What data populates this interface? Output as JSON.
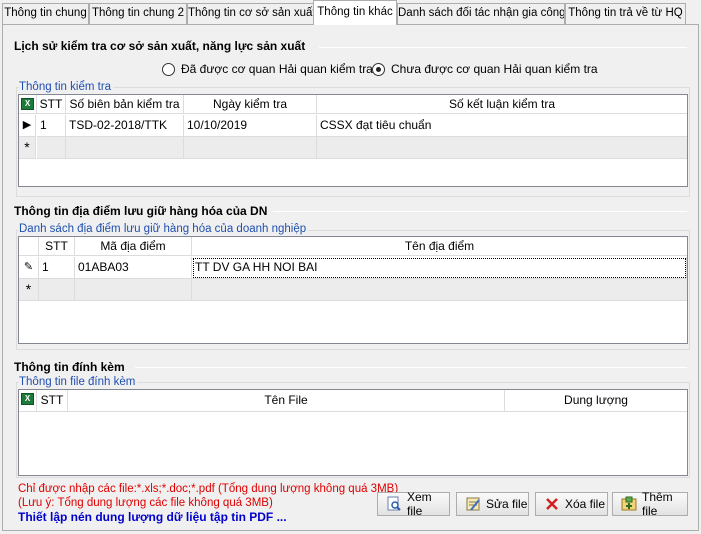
{
  "tabs": [
    {
      "label": "Thông tin chung"
    },
    {
      "label": "Thông tin chung 2"
    },
    {
      "label": "Thông tin cơ sở sản xuất"
    },
    {
      "label": "Thông tin khác"
    },
    {
      "label": "Danh sách đối tác nhận gia công"
    },
    {
      "label": "Thông tin trả về từ HQ"
    }
  ],
  "inspection": {
    "section_title": "Lịch sử kiểm tra cơ sở sản xuất, năng lực sản xuất",
    "radio_checked_label": "Đã được cơ quan Hải quan kiểm tra",
    "radio_unchecked_label": "Chưa được cơ quan Hải quan kiểm tra",
    "group_title": "Thông tin kiểm tra",
    "columns": [
      "STT",
      "Số biên bản kiểm tra",
      "Ngày kiểm tra",
      "Số kết luận kiểm tra"
    ],
    "rows": [
      [
        "1",
        "TSD-02-2018/TTK",
        "10/10/2019",
        "CSSX đạt tiêu chuẩn"
      ]
    ]
  },
  "storage": {
    "section_title": "Thông tin địa điểm lưu giữ hàng hóa của DN",
    "group_title": "Danh sách địa điểm lưu giữ hàng hóa của doanh nghiệp",
    "columns": [
      "STT",
      "Mã địa điểm",
      "Tên địa điểm"
    ],
    "rows": [
      [
        "1",
        "01ABA03",
        "TT DV GA HH NOI BAI"
      ]
    ]
  },
  "attachments": {
    "section_title": "Thông tin đính kèm",
    "group_title": "Thông tin file đính kèm",
    "columns": [
      "STT",
      "Tên File",
      "Dung lượng"
    ],
    "note_types": "Chỉ được nhập các file:*.xls;*.doc;*.pdf (Tổng dung lượng không quá 3MB)",
    "note_size": "(Lưu ý: Tổng dung lượng các file không quá 3MB)",
    "pdf_link": "Thiết lập nén dung lượng dữ liệu tập tin PDF ...",
    "buttons": {
      "view": "Xem file",
      "edit": "Sửa file",
      "delete": "Xóa file",
      "add": "Thêm file"
    }
  },
  "grid_symbols": {
    "current_row": "▶",
    "editing_row": "✎",
    "new_row": "*",
    "excel_icon": "X"
  }
}
